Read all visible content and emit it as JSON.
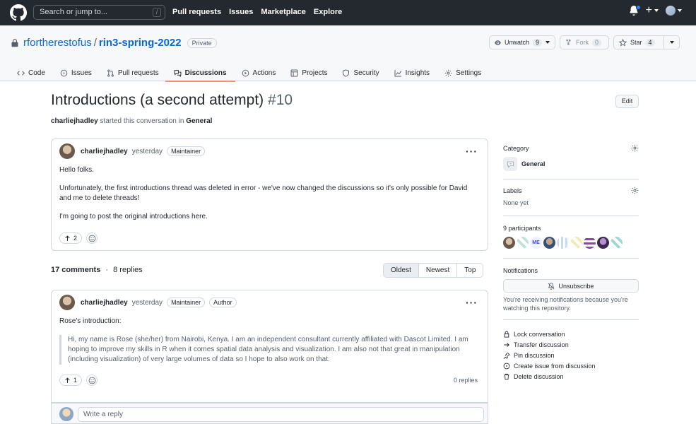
{
  "header": {
    "search_placeholder": "Search or jump to...",
    "search_shortcut": "/",
    "nav": [
      "Pull requests",
      "Issues",
      "Marketplace",
      "Explore"
    ]
  },
  "repo": {
    "owner": "rfortherestofus",
    "separator": "/",
    "name": "rin3-spring-2022",
    "visibility": "Private",
    "unwatch_label": "Unwatch",
    "watch_count": "9",
    "fork_label": "Fork",
    "fork_count": "0",
    "star_label": "Star",
    "star_count": "4"
  },
  "tabs": [
    {
      "label": "Code",
      "icon": "code-icon"
    },
    {
      "label": "Issues",
      "icon": "issue-icon"
    },
    {
      "label": "Pull requests",
      "icon": "pull-request-icon"
    },
    {
      "label": "Discussions",
      "icon": "discussion-icon",
      "active": true
    },
    {
      "label": "Actions",
      "icon": "play-icon"
    },
    {
      "label": "Projects",
      "icon": "table-icon"
    },
    {
      "label": "Security",
      "icon": "shield-icon"
    },
    {
      "label": "Insights",
      "icon": "graph-icon"
    },
    {
      "label": "Settings",
      "icon": "gear-icon"
    }
  ],
  "discussion": {
    "title": "Introductions (a second attempt)",
    "number": "#10",
    "edit_label": "Edit",
    "author": "charliejhadley",
    "started_text": "started this conversation in",
    "category": "General"
  },
  "post": {
    "author": "charliejhadley",
    "time": "yesterday",
    "badge": "Maintainer",
    "paragraphs": [
      "Hello folks.",
      "Unfortunately, the first introductions thread was deleted in error - we've now changed the discussions so it's only possible for David and me to delete threads!",
      "I'm going to post the original introductions here."
    ],
    "upvotes": "2"
  },
  "comments_summary": {
    "comments": "17 comments",
    "dot": "·",
    "replies": "8 replies",
    "sort_options": [
      "Oldest",
      "Newest",
      "Top"
    ],
    "sort_selected": "Oldest"
  },
  "comment": {
    "author": "charliejhadley",
    "time": "yesterday",
    "badges": [
      "Maintainer",
      "Author"
    ],
    "intro": "Rose's introduction:",
    "quote": "Hi, my name is Rose (she/her) from Nairobi, Kenya. I am an independent consultant currently affiliated with Dascot Limited. I am hoping to improve my skills in R when it comes spatial data analysis and visualization. I am also not that great in manipulation (including visualization) of very large volumes of data so I hope to also work on that.",
    "upvotes": "1",
    "replies": "0 replies",
    "reply_placeholder": "Write a reply"
  },
  "sidebar": {
    "category_heading": "Category",
    "category_value": "General",
    "labels_heading": "Labels",
    "labels_value": "None yet",
    "participants_heading": "9 participants",
    "notifications_heading": "Notifications",
    "unsubscribe_label": "Unsubscribe",
    "notification_note": "You're receiving notifications because you're watching this repository.",
    "actions": [
      {
        "label": "Lock conversation",
        "icon": "lock-icon"
      },
      {
        "label": "Transfer discussion",
        "icon": "arrow-right-icon"
      },
      {
        "label": "Pin discussion",
        "icon": "pin-icon"
      },
      {
        "label": "Create issue from discussion",
        "icon": "issue-opened-icon"
      },
      {
        "label": "Delete discussion",
        "icon": "trash-icon"
      }
    ]
  },
  "colors": {
    "header_bg": "#24292f",
    "link": "#0969da",
    "active_tab_underline": "#fd8c73",
    "border": "#d0d7de"
  }
}
